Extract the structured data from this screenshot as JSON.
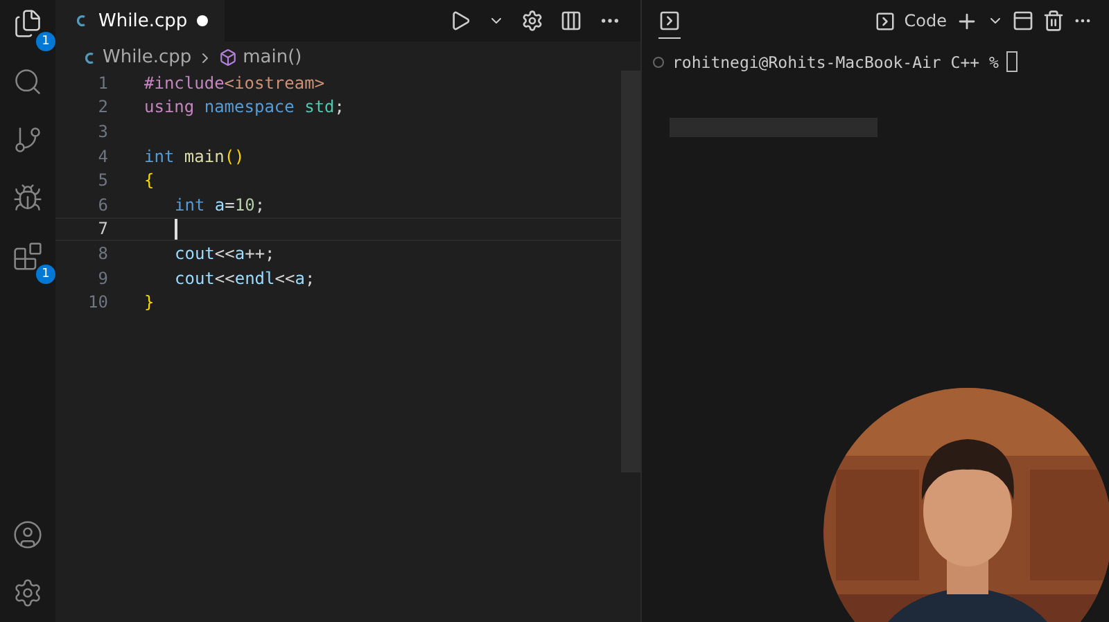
{
  "activity_bar": {
    "items": [
      {
        "badge": "1",
        "selected": true
      },
      {
        "selected": false
      },
      {
        "selected": false
      },
      {
        "selected": false
      },
      {
        "badge": "1",
        "selected": false
      }
    ]
  },
  "editor": {
    "tab": {
      "label": "While.cpp",
      "modified": true
    },
    "breadcrumb": {
      "file": "While.cpp",
      "symbol": "main()"
    },
    "lines": [
      {
        "number": "1",
        "indented": false,
        "current": false,
        "tokens": [
          {
            "text": "#include",
            "kind": "directive"
          },
          {
            "text": "<iostream>",
            "kind": "string"
          }
        ]
      },
      {
        "number": "2",
        "indented": false,
        "current": false,
        "tokens": [
          {
            "text": "using",
            "kind": "control"
          },
          {
            "text": " namespace",
            "kind": "keyword"
          },
          {
            "text": " std",
            "kind": "type"
          },
          {
            "text": ";",
            "kind": "plain"
          }
        ]
      },
      {
        "number": "3",
        "current": false
      },
      {
        "number": "4",
        "indented": false,
        "current": false,
        "tokens": [
          {
            "text": "int",
            "kind": "keyword"
          },
          {
            "text": " main",
            "kind": "function"
          },
          {
            "text": "()",
            "kind": "bracket"
          }
        ]
      },
      {
        "number": "5",
        "indented": false,
        "current": false,
        "tokens": [
          {
            "text": "{",
            "kind": "bracket"
          }
        ]
      },
      {
        "number": "6",
        "indented": true,
        "current": false,
        "tokens": [
          {
            "text": "int",
            "kind": "keyword"
          },
          {
            "text": " a",
            "kind": "variable"
          },
          {
            "text": "=",
            "kind": "plain"
          },
          {
            "text": "10",
            "kind": "number"
          },
          {
            "text": ";",
            "kind": "plain"
          }
        ]
      },
      {
        "number": "7",
        "indented": true,
        "current": true
      },
      {
        "number": "8",
        "indented": true,
        "current": false,
        "tokens": [
          {
            "text": "cout",
            "kind": "variable"
          },
          {
            "text": "<<",
            "kind": "plain"
          },
          {
            "text": "a",
            "kind": "variable"
          },
          {
            "text": "++;",
            "kind": "plain"
          }
        ]
      },
      {
        "number": "9",
        "indented": true,
        "current": false,
        "tokens": [
          {
            "text": "cout",
            "kind": "variable"
          },
          {
            "text": "<<",
            "kind": "plain"
          },
          {
            "text": "endl",
            "kind": "variable"
          },
          {
            "text": "<<",
            "kind": "plain"
          },
          {
            "text": "a",
            "kind": "variable"
          },
          {
            "text": ";",
            "kind": "plain"
          }
        ]
      },
      {
        "number": "10",
        "indented": false,
        "current": false,
        "tokens": [
          {
            "text": "}",
            "kind": "bracket"
          }
        ]
      }
    ]
  },
  "terminal": {
    "profile": "Code",
    "prompt": "rohitnegi@Rohits-MacBook-Air C++ %"
  }
}
